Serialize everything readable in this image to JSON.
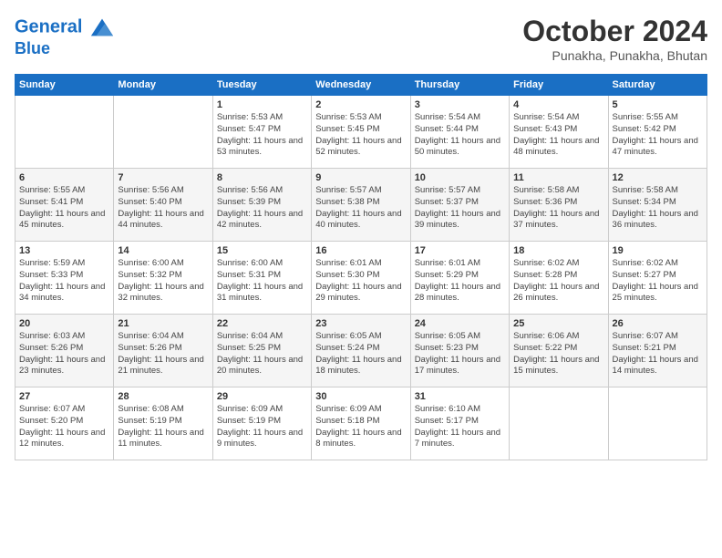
{
  "header": {
    "logo_line1": "General",
    "logo_line2": "Blue",
    "month": "October 2024",
    "location": "Punakha, Punakha, Bhutan"
  },
  "days_of_week": [
    "Sunday",
    "Monday",
    "Tuesday",
    "Wednesday",
    "Thursday",
    "Friday",
    "Saturday"
  ],
  "weeks": [
    [
      {
        "day": "",
        "info": ""
      },
      {
        "day": "",
        "info": ""
      },
      {
        "day": "1",
        "info": "Sunrise: 5:53 AM\nSunset: 5:47 PM\nDaylight: 11 hours and 53 minutes."
      },
      {
        "day": "2",
        "info": "Sunrise: 5:53 AM\nSunset: 5:45 PM\nDaylight: 11 hours and 52 minutes."
      },
      {
        "day": "3",
        "info": "Sunrise: 5:54 AM\nSunset: 5:44 PM\nDaylight: 11 hours and 50 minutes."
      },
      {
        "day": "4",
        "info": "Sunrise: 5:54 AM\nSunset: 5:43 PM\nDaylight: 11 hours and 48 minutes."
      },
      {
        "day": "5",
        "info": "Sunrise: 5:55 AM\nSunset: 5:42 PM\nDaylight: 11 hours and 47 minutes."
      }
    ],
    [
      {
        "day": "6",
        "info": "Sunrise: 5:55 AM\nSunset: 5:41 PM\nDaylight: 11 hours and 45 minutes."
      },
      {
        "day": "7",
        "info": "Sunrise: 5:56 AM\nSunset: 5:40 PM\nDaylight: 11 hours and 44 minutes."
      },
      {
        "day": "8",
        "info": "Sunrise: 5:56 AM\nSunset: 5:39 PM\nDaylight: 11 hours and 42 minutes."
      },
      {
        "day": "9",
        "info": "Sunrise: 5:57 AM\nSunset: 5:38 PM\nDaylight: 11 hours and 40 minutes."
      },
      {
        "day": "10",
        "info": "Sunrise: 5:57 AM\nSunset: 5:37 PM\nDaylight: 11 hours and 39 minutes."
      },
      {
        "day": "11",
        "info": "Sunrise: 5:58 AM\nSunset: 5:36 PM\nDaylight: 11 hours and 37 minutes."
      },
      {
        "day": "12",
        "info": "Sunrise: 5:58 AM\nSunset: 5:34 PM\nDaylight: 11 hours and 36 minutes."
      }
    ],
    [
      {
        "day": "13",
        "info": "Sunrise: 5:59 AM\nSunset: 5:33 PM\nDaylight: 11 hours and 34 minutes."
      },
      {
        "day": "14",
        "info": "Sunrise: 6:00 AM\nSunset: 5:32 PM\nDaylight: 11 hours and 32 minutes."
      },
      {
        "day": "15",
        "info": "Sunrise: 6:00 AM\nSunset: 5:31 PM\nDaylight: 11 hours and 31 minutes."
      },
      {
        "day": "16",
        "info": "Sunrise: 6:01 AM\nSunset: 5:30 PM\nDaylight: 11 hours and 29 minutes."
      },
      {
        "day": "17",
        "info": "Sunrise: 6:01 AM\nSunset: 5:29 PM\nDaylight: 11 hours and 28 minutes."
      },
      {
        "day": "18",
        "info": "Sunrise: 6:02 AM\nSunset: 5:28 PM\nDaylight: 11 hours and 26 minutes."
      },
      {
        "day": "19",
        "info": "Sunrise: 6:02 AM\nSunset: 5:27 PM\nDaylight: 11 hours and 25 minutes."
      }
    ],
    [
      {
        "day": "20",
        "info": "Sunrise: 6:03 AM\nSunset: 5:26 PM\nDaylight: 11 hours and 23 minutes."
      },
      {
        "day": "21",
        "info": "Sunrise: 6:04 AM\nSunset: 5:26 PM\nDaylight: 11 hours and 21 minutes."
      },
      {
        "day": "22",
        "info": "Sunrise: 6:04 AM\nSunset: 5:25 PM\nDaylight: 11 hours and 20 minutes."
      },
      {
        "day": "23",
        "info": "Sunrise: 6:05 AM\nSunset: 5:24 PM\nDaylight: 11 hours and 18 minutes."
      },
      {
        "day": "24",
        "info": "Sunrise: 6:05 AM\nSunset: 5:23 PM\nDaylight: 11 hours and 17 minutes."
      },
      {
        "day": "25",
        "info": "Sunrise: 6:06 AM\nSunset: 5:22 PM\nDaylight: 11 hours and 15 minutes."
      },
      {
        "day": "26",
        "info": "Sunrise: 6:07 AM\nSunset: 5:21 PM\nDaylight: 11 hours and 14 minutes."
      }
    ],
    [
      {
        "day": "27",
        "info": "Sunrise: 6:07 AM\nSunset: 5:20 PM\nDaylight: 11 hours and 12 minutes."
      },
      {
        "day": "28",
        "info": "Sunrise: 6:08 AM\nSunset: 5:19 PM\nDaylight: 11 hours and 11 minutes."
      },
      {
        "day": "29",
        "info": "Sunrise: 6:09 AM\nSunset: 5:19 PM\nDaylight: 11 hours and 9 minutes."
      },
      {
        "day": "30",
        "info": "Sunrise: 6:09 AM\nSunset: 5:18 PM\nDaylight: 11 hours and 8 minutes."
      },
      {
        "day": "31",
        "info": "Sunrise: 6:10 AM\nSunset: 5:17 PM\nDaylight: 11 hours and 7 minutes."
      },
      {
        "day": "",
        "info": ""
      },
      {
        "day": "",
        "info": ""
      }
    ]
  ]
}
